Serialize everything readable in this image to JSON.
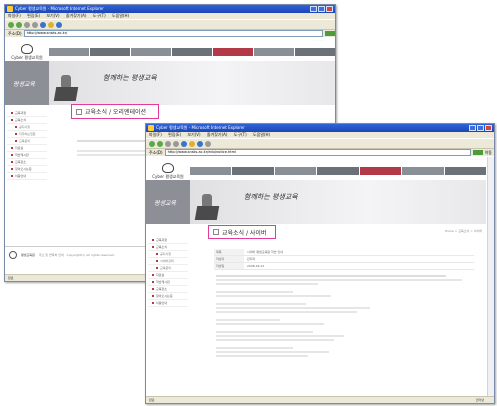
{
  "back_window": {
    "title": "Cyber 평생교육원 - Microsoft Internet Explorer",
    "menu": [
      "파일(F)",
      "편집(E)",
      "보기(V)",
      "즐겨찾기(A)",
      "도구(T)",
      "도움말(H)"
    ],
    "address_label": "주소(D)",
    "address": "http://www.snsks.ac.kr/",
    "logo_text": "Cyber 평생교육원",
    "banner_left": "평생교육",
    "slogan": "함께하는 평생교육",
    "callout_label": "교육소식 / 오리엔테이션",
    "sidebar": [
      "교육과정",
      "교육소식",
      "공지사항",
      "자주하는질문",
      "교육문의",
      "자료실",
      "학습게시판",
      "교육장소",
      "찾아오시는길",
      "이용안내"
    ],
    "footer_org": "평생교육원",
    "footer_text": "주소 및 연락처 안내 · Copyright(c) All rights reserved.",
    "status": "완료"
  },
  "front_window": {
    "title": "Cyber 평생교육원 - Microsoft Internet Explorer",
    "menu": [
      "파일(F)",
      "편집(E)",
      "보기(V)",
      "즐겨찾기(A)",
      "도구(T)",
      "도움말(H)"
    ],
    "address_label": "주소(D)",
    "address": "http://www.snsks.ac.kr/edu/notice.html",
    "go_label": "이동",
    "logo_text": "Cyber 평생교육원",
    "banner_left": "평생교육",
    "slogan": "함께하는 평생교육",
    "callout_label": "교육소식 / 사이버",
    "breadcrumb": "Home > 교육소식 > 사이버",
    "sidebar": [
      "교육과정",
      "교육소식",
      "공지사항",
      "사이버강좌",
      "교육문의",
      "자료실",
      "학습게시판",
      "교육장소",
      "찾아오시는길",
      "이용안내"
    ],
    "table_rows": [
      {
        "k": "제목",
        "v": "사이버 평생교육원 학습 안내"
      },
      {
        "k": "작성자",
        "v": "관리자"
      },
      {
        "k": "작성일",
        "v": "2008-04-21"
      }
    ],
    "status": "완료",
    "status_right": "인터넷"
  },
  "colors": {
    "accent_pink": "#e23c9a",
    "titlebar_blue": "#2f63d8",
    "nav_gray": "#8a8f97",
    "brand_red": "#b23a48"
  }
}
